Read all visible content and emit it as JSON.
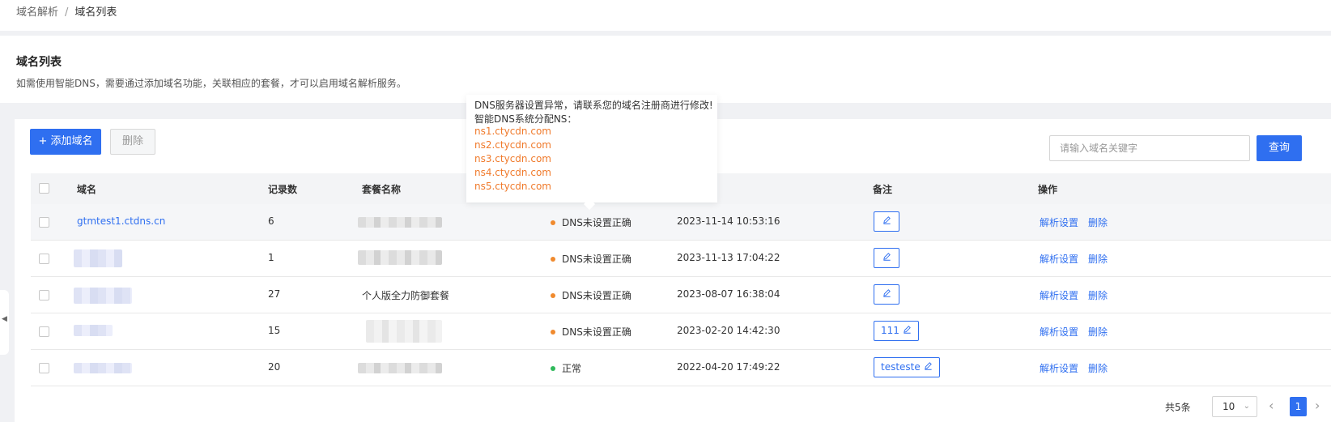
{
  "breadcrumb": {
    "parent": "域名解析",
    "separator": "/",
    "current": "域名列表"
  },
  "header": {
    "title": "域名列表",
    "description": "如需使用智能DNS，需要通过添加域名功能，关联相应的套餐，才可以启用域名解析服务。"
  },
  "toolbar": {
    "add_label": "+ 添加域名",
    "delete_label": "删除",
    "search_placeholder": "请输入域名关键字",
    "search_label": "查询"
  },
  "table": {
    "columns": [
      "域名",
      "记录数",
      "套餐名称",
      "备注",
      "操作"
    ],
    "rows": [
      {
        "domain": "gtmtest1.ctdns.cn",
        "records": "6",
        "package": "",
        "status": "DNS未设置正确",
        "time": "2023-11-14 10:53:16",
        "note": "",
        "actions": [
          "解析设置",
          "删除"
        ]
      },
      {
        "domain": "",
        "records": "1",
        "package": "",
        "status": "DNS未设置正确",
        "time": "2023-11-13 17:04:22",
        "note": "",
        "actions": [
          "解析设置",
          "删除"
        ]
      },
      {
        "domain": "",
        "records": "27",
        "package": "个人版全力防御套餐",
        "status": "DNS未设置正确",
        "time": "2023-08-07 16:38:04",
        "note": "",
        "actions": [
          "解析设置",
          "删除"
        ]
      },
      {
        "domain": "",
        "records": "15",
        "package": "",
        "status": "DNS未设置正确",
        "time": "2023-02-20 14:42:30",
        "note": "111",
        "actions": [
          "解析设置",
          "删除"
        ]
      },
      {
        "domain": "",
        "records": "20",
        "package": "",
        "status": "正常",
        "time": "2022-04-20 17:49:22",
        "note": "testeste",
        "actions": [
          "解析设置",
          "删除"
        ]
      }
    ]
  },
  "tooltip": {
    "line1": "DNS服务器设置异常，请联系您的域名注册商进行修改!",
    "line2": "智能DNS系统分配NS：",
    "ns": [
      "ns1.ctycdn.com",
      "ns2.ctycdn.com",
      "ns3.ctycdn.com",
      "ns4.ctycdn.com",
      "ns5.ctycdn.com"
    ]
  },
  "pagination": {
    "total": "共5条",
    "page_size": "10",
    "current_page": "1"
  },
  "colors": {
    "primary": "#2f6ff0",
    "warning_dot": "#f08a2e",
    "ok_dot": "#2fb95a",
    "ns_text": "#f07a2b"
  },
  "icons": {
    "edit": "pencil-icon",
    "sidebar_toggle": "triangle-left-icon",
    "prev": "chevron-left-icon",
    "next": "chevron-right-icon",
    "dropdown": "chevron-down-icon"
  }
}
